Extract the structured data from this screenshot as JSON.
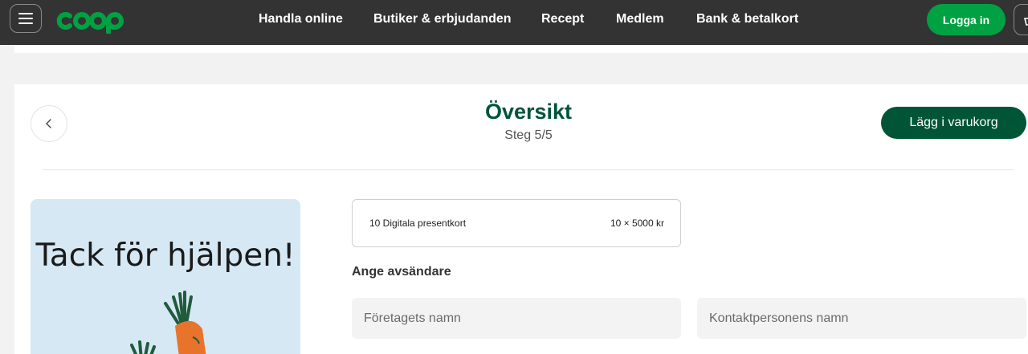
{
  "header": {
    "menu_icon": "hamburger-icon",
    "logo_text": "coop",
    "nav": [
      "Handla online",
      "Butiker & erbjudanden",
      "Recept",
      "Medlem",
      "Bank & betalkort"
    ],
    "login_label": "Logga in",
    "cart_icon": "basket-icon"
  },
  "page": {
    "title": "Översikt",
    "step": "Steg 5/5",
    "add_to_cart_label": "Lägg i varukorg",
    "back_icon": "chevron-left-icon"
  },
  "giftcard": {
    "text": "Tack för hjälpen!"
  },
  "summary": {
    "item": "10 Digitala presentkort",
    "price": "10 × 5000 kr"
  },
  "sender": {
    "label": "Ange avsändare",
    "company_placeholder": "Företagets namn",
    "contact_placeholder": "Kontaktpersonens namn"
  },
  "colors": {
    "header_bg": "#333333",
    "brand_green": "#00a142",
    "dark_green": "#005537"
  }
}
